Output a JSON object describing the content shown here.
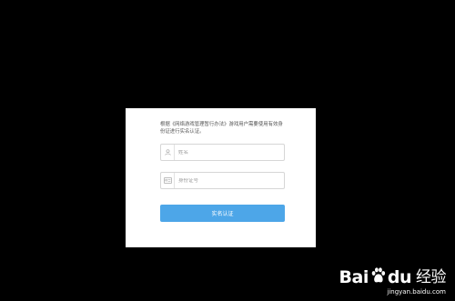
{
  "dialog": {
    "notice": "根据《网络游戏管理暂行办法》游戏用户需要使用有效身份证进行实名认证。",
    "name_field": {
      "placeholder": "姓名",
      "icon": "user-icon"
    },
    "id_field": {
      "placeholder": "身份证号",
      "icon": "id-card-icon"
    },
    "submit_label": "实名认证"
  },
  "watermark": {
    "brand_a": "Bai",
    "brand_b": "du",
    "brand_cn": "经验",
    "url": "jingyan.baidu.com"
  },
  "colors": {
    "background": "#000000",
    "dialog": "#ffffff",
    "button": "#4da6e8"
  }
}
